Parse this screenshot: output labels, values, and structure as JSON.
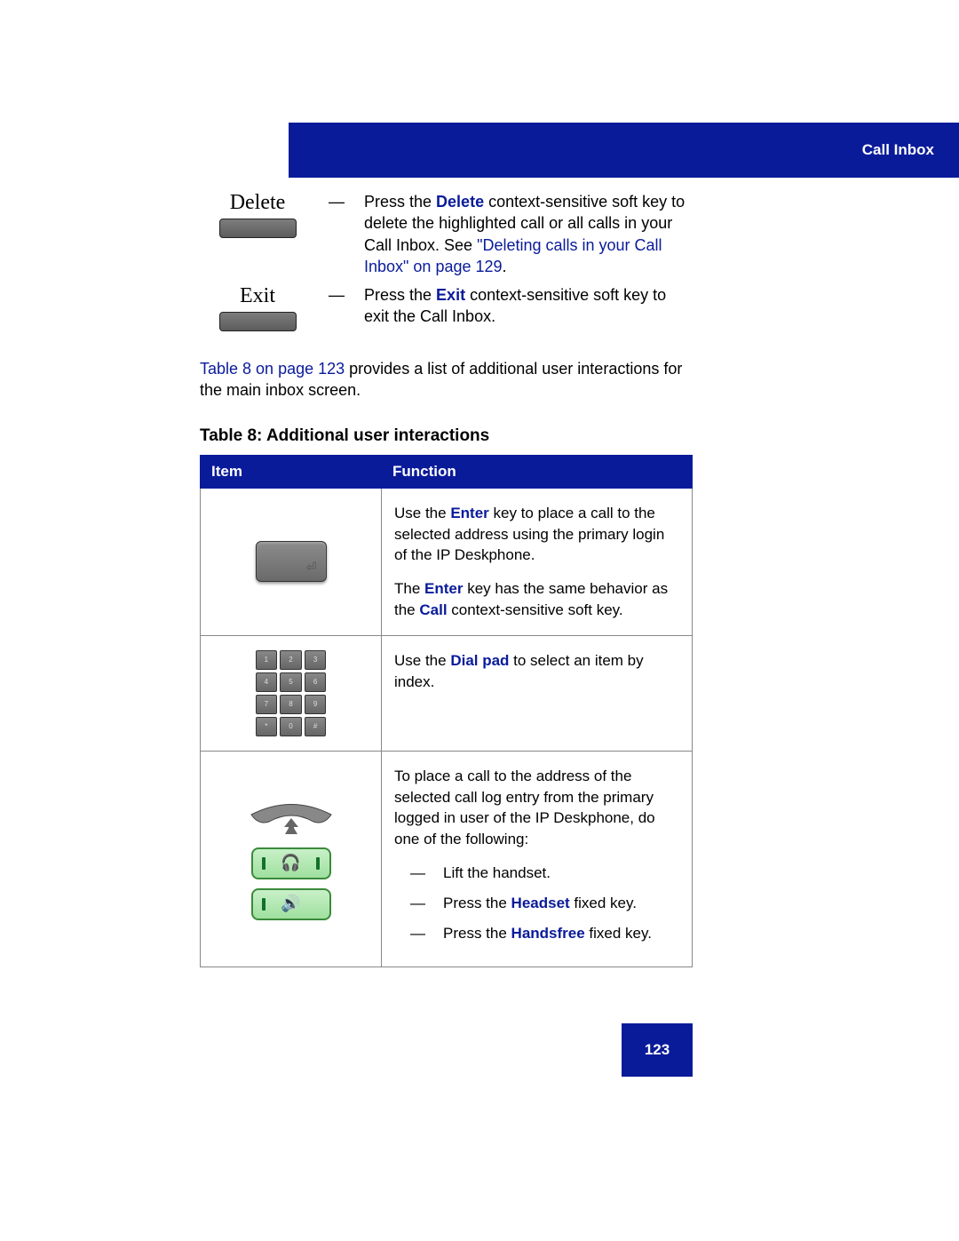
{
  "header": {
    "title": "Call Inbox"
  },
  "softkeys": {
    "delete": {
      "label": "Delete",
      "desc_prefix": "Press the ",
      "desc_bold": "Delete",
      "desc_mid": " context-sensitive soft key to delete the highlighted call or all calls in your Call Inbox. See ",
      "desc_link": "\"Deleting calls in your Call Inbox\" on page 129",
      "desc_suffix": "."
    },
    "exit": {
      "label": "Exit",
      "desc_prefix": "Press the ",
      "desc_bold": "Exit",
      "desc_suffix": " context-sensitive soft key to exit the Call Inbox."
    }
  },
  "prepara": {
    "link": "Table 8 on page 123",
    "rest": " provides a list of additional user interactions for the main inbox screen."
  },
  "table": {
    "title": "Table 8: Additional user interactions",
    "headers": {
      "item": "Item",
      "function": "Function"
    },
    "rows": {
      "enter": {
        "p1_a": "Use the ",
        "p1_b": "Enter",
        "p1_c": " key to place a call to the selected address using the primary login of the IP Deskphone.",
        "p2_a": "The ",
        "p2_b": "Enter",
        "p2_c": " key has the same behavior as the ",
        "p2_d": "Call",
        "p2_e": " context-sensitive soft key."
      },
      "dialpad": {
        "a": "Use the ",
        "b": "Dial pad",
        "c": " to select an item by index."
      },
      "place": {
        "intro": "To place a call to the address of the selected call log entry from the primary logged in user of the IP Deskphone, do one of the following:",
        "li1": "Lift the handset.",
        "li2_a": "Press the ",
        "li2_b": "Headset",
        "li2_c": " fixed key.",
        "li3_a": "Press the ",
        "li3_b": "Handsfree",
        "li3_c": " fixed key."
      }
    }
  },
  "page_number": "123",
  "dialpad_keys": [
    "1",
    "2",
    "3",
    "4",
    "5",
    "6",
    "7",
    "8",
    "9",
    "*",
    "0",
    "#"
  ]
}
